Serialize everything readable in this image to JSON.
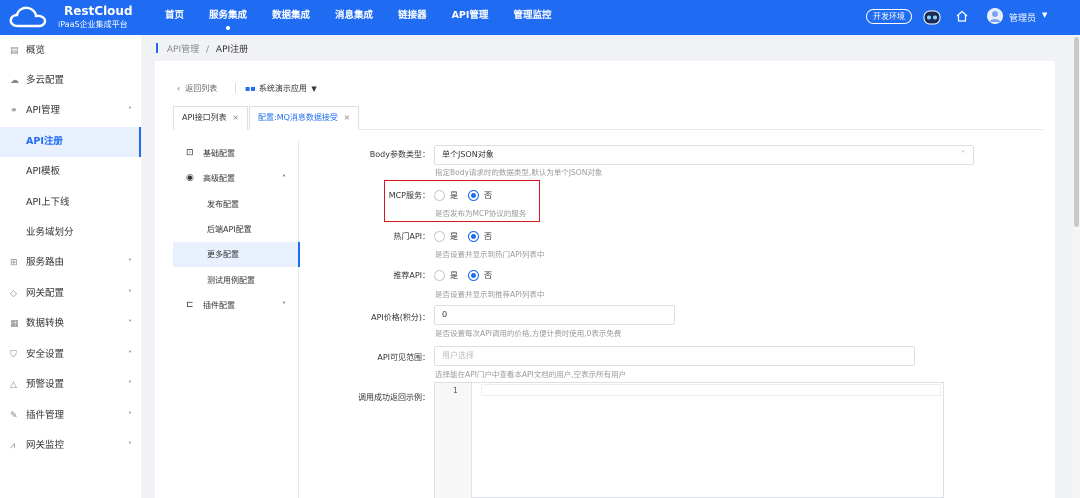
{
  "brand": {
    "title": "RestCloud",
    "subtitle": "iPaaS企业集成平台"
  },
  "nav": [
    {
      "label": "首页",
      "active": false
    },
    {
      "label": "服务集成",
      "active": true
    },
    {
      "label": "数据集成",
      "active": false
    },
    {
      "label": "消息集成",
      "active": false
    },
    {
      "label": "链接器",
      "active": false
    },
    {
      "label": "API管理",
      "active": false
    },
    {
      "label": "管理监控",
      "active": false
    }
  ],
  "header": {
    "env": "开发环境",
    "user": "管理员"
  },
  "sidebar": [
    {
      "icon": "overview-icon",
      "label": "概览"
    },
    {
      "icon": "cloud-icon",
      "label": "多云配置"
    },
    {
      "icon": "link-icon",
      "label": "API管理"
    },
    {
      "label": "API注册"
    },
    {
      "label": "API模板"
    },
    {
      "label": "API上下线"
    },
    {
      "label": "业务域划分"
    },
    {
      "icon": "route-icon",
      "label": "服务路由"
    },
    {
      "icon": "tag-icon",
      "label": "网关配置"
    },
    {
      "icon": "list-icon",
      "label": "数据转换"
    },
    {
      "icon": "shield-icon",
      "label": "安全设置"
    },
    {
      "icon": "warning-icon",
      "label": "预警设置"
    },
    {
      "icon": "edit-icon",
      "label": "插件管理"
    },
    {
      "icon": "chart-icon",
      "label": "网关监控"
    }
  ],
  "breadcrumb": {
    "parent": "API管理",
    "sep": "/",
    "current": "API注册"
  },
  "toolbar": {
    "back": "返回列表",
    "app": "系统演示应用"
  },
  "tabs": [
    {
      "label": "API接口列表"
    },
    {
      "label": "配置:MQ消息数据接受"
    }
  ],
  "config_menu": [
    {
      "label": "基础配置"
    },
    {
      "label": "高级配置"
    },
    {
      "label": "发布配置"
    },
    {
      "label": "后端API配置"
    },
    {
      "label": "更多配置"
    },
    {
      "label": "测试用例配置"
    },
    {
      "label": "插件配置"
    }
  ],
  "form": {
    "body_type": {
      "label": "Body参数类型：",
      "value": "单个JSON对象",
      "hint": "指定Body请求时的数据类型,默认为单个JSON对象"
    },
    "mcp": {
      "label": "MCP服务：",
      "yes": "是",
      "no": "否",
      "selected": "no",
      "hint": "是否发布为MCP协议的服务"
    },
    "hot": {
      "label": "热门API：",
      "yes": "是",
      "no": "否",
      "selected": "no",
      "hint": "是否设置并显示到热门API列表中"
    },
    "recommend": {
      "label": "推荐API：",
      "yes": "是",
      "no": "否",
      "selected": "no",
      "hint": "是否设置并显示到推荐API列表中"
    },
    "price": {
      "label": "API价格(积分)：",
      "value": "0",
      "hint": "是否设置每次API调用的价格,方便计费时使用,0表示免费"
    },
    "scope": {
      "label": "API可见范围：",
      "placeholder": "用户选择",
      "hint": "选择能在API门户中查看本API文档的用户,空表示所有用户"
    },
    "example": {
      "label": "调用成功返回示例：",
      "line": "1"
    }
  }
}
